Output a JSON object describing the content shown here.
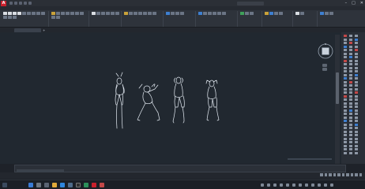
{
  "titlebar": {
    "app_logo": "A",
    "title": "",
    "controls": [
      "–",
      "□",
      "✕"
    ]
  },
  "ribbon": {
    "tabs": [],
    "panels": []
  },
  "document": {
    "tab_label": "",
    "add_tab": "+"
  },
  "canvas": {
    "viewport_label": "",
    "figures": [
      "figure-1",
      "figure-2",
      "figure-3",
      "figure-4"
    ]
  },
  "command": {
    "history": "",
    "placeholder": ""
  },
  "layout_tabs": [],
  "taskbar": {
    "time": "",
    "date": ""
  },
  "colors": {
    "canvas_bg": "#212830",
    "drawing_stroke": "#e6edf5",
    "accent": "#3e7fd0",
    "app_red": "#c8202c"
  }
}
